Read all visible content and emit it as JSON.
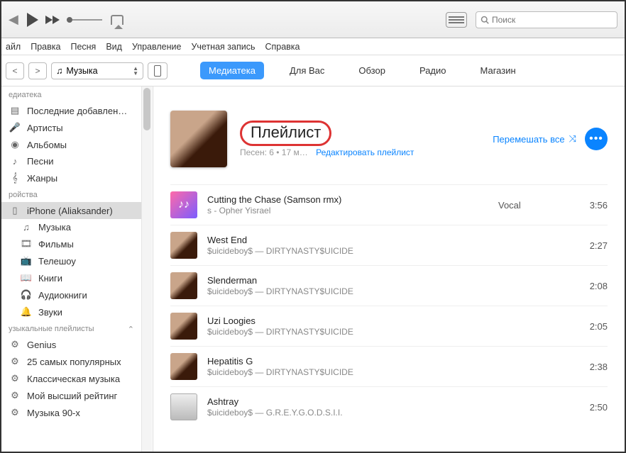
{
  "toolbar": {
    "search_placeholder": "Поиск"
  },
  "menubar": [
    "айл",
    "Правка",
    "Песня",
    "Вид",
    "Управление",
    "Учетная запись",
    "Справка"
  ],
  "subbar": {
    "media_label": "Музыка",
    "tabs": [
      "Медиатека",
      "Для Вас",
      "Обзор",
      "Радио",
      "Магазин"
    ],
    "active": 0
  },
  "sidebar": {
    "sections": [
      {
        "title": "едиатека",
        "items": [
          {
            "icon": "recent",
            "label": "Последние добавлен…"
          },
          {
            "icon": "artist",
            "label": "Артисты"
          },
          {
            "icon": "album",
            "label": "Альбомы"
          },
          {
            "icon": "song",
            "label": "Песни"
          },
          {
            "icon": "genre",
            "label": "Жанры"
          }
        ]
      },
      {
        "title": "ройства",
        "items": [
          {
            "icon": "phone",
            "label": "iPhone (Aliaksander)",
            "selected": true
          },
          {
            "icon": "music",
            "label": "Музыка",
            "indent": true
          },
          {
            "icon": "film",
            "label": "Фильмы",
            "indent": true
          },
          {
            "icon": "tv",
            "label": "Телешоу",
            "indent": true
          },
          {
            "icon": "book",
            "label": "Книги",
            "indent": true
          },
          {
            "icon": "audio",
            "label": "Аудиокниги",
            "indent": true
          },
          {
            "icon": "bell",
            "label": "Звуки",
            "indent": true
          }
        ]
      },
      {
        "title": "узыкальные плейлисты",
        "chevron": true,
        "items": [
          {
            "icon": "gear",
            "label": "Genius"
          },
          {
            "icon": "gear",
            "label": "25 самых популярных"
          },
          {
            "icon": "gear",
            "label": "Классическая музыка"
          },
          {
            "icon": "gear",
            "label": "Мой высший рейтинг"
          },
          {
            "icon": "gear",
            "label": "Музыка 90-х"
          }
        ]
      }
    ]
  },
  "playlist": {
    "title": "Плейлист",
    "meta": "Песен: 6 • 17 м…",
    "edit_link": "Редактировать плейлист",
    "shuffle_label": "Перемешать все",
    "tracks": [
      {
        "art": "music",
        "title": "Cutting the Chase (Samson rmx)",
        "sub": "s - Opher Yisrael",
        "col": "Vocal",
        "dur": "3:56"
      },
      {
        "art": "face",
        "title": "West End",
        "sub": "$uicideboy$ — DIRTYNASTY$UICIDE",
        "col": "",
        "dur": "2:27"
      },
      {
        "art": "face",
        "title": "Slenderman",
        "sub": "$uicideboy$ — DIRTYNASTY$UICIDE",
        "col": "",
        "dur": "2:08"
      },
      {
        "art": "face",
        "title": "Uzi Loogies",
        "sub": "$uicideboy$ — DIRTYNASTY$UICIDE",
        "col": "",
        "dur": "2:05"
      },
      {
        "art": "face",
        "title": "Hepatitis G",
        "sub": "$uicideboy$ — DIRTYNASTY$UICIDE",
        "col": "",
        "dur": "2:38"
      },
      {
        "art": "bw",
        "title": "Ashtray",
        "sub": "$uicideboy$ — G.R.E.Y.G.O.D.S.I.I.",
        "col": "",
        "dur": "2:50"
      }
    ]
  }
}
